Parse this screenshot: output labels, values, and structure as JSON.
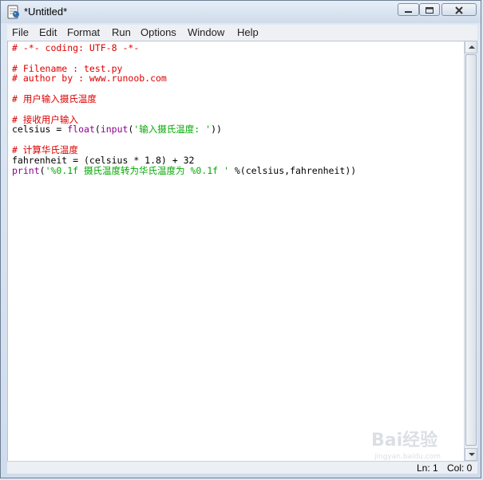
{
  "window": {
    "title": "*Untitled*"
  },
  "menu": [
    "File",
    "Edit",
    "Format",
    "Run",
    "Options",
    "Window",
    "Help"
  ],
  "editor": {
    "lines": [
      [
        {
          "t": "# -*- coding: UTF-8 -*-",
          "c": "comment"
        }
      ],
      [],
      [
        {
          "t": "# Filename : test.py",
          "c": "comment"
        }
      ],
      [
        {
          "t": "# author by : www.runoob.com",
          "c": "comment"
        }
      ],
      [],
      [
        {
          "t": "# 用户输入摄氏温度",
          "c": "comment"
        }
      ],
      [],
      [
        {
          "t": "# 接收用户输入",
          "c": "comment"
        }
      ],
      [
        {
          "t": "celsius = ",
          "c": "plain"
        },
        {
          "t": "float",
          "c": "builtin"
        },
        {
          "t": "(",
          "c": "plain"
        },
        {
          "t": "input",
          "c": "builtin"
        },
        {
          "t": "(",
          "c": "plain"
        },
        {
          "t": "'输入摄氏温度: '",
          "c": "string"
        },
        {
          "t": "))",
          "c": "plain"
        }
      ],
      [],
      [
        {
          "t": "# 计算华氏温度",
          "c": "comment"
        }
      ],
      [
        {
          "t": "fahrenheit = (celsius * 1.8) + 32",
          "c": "plain"
        }
      ],
      [
        {
          "t": "print",
          "c": "builtin"
        },
        {
          "t": "(",
          "c": "plain"
        },
        {
          "t": "'%0.1f 摄氏温度转为华氏温度为 %0.1f '",
          "c": "string"
        },
        {
          "t": " %(celsius,fahrenheit))",
          "c": "plain"
        }
      ]
    ]
  },
  "status": {
    "ln": "Ln: 1",
    "col": "Col: 0"
  },
  "watermark": {
    "text": "Bai经验",
    "sub": "jingyan.baidu.com"
  }
}
